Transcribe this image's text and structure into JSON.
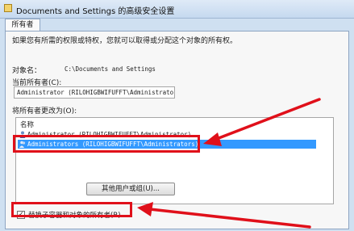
{
  "window": {
    "title": "Documents and Settings 的高级安全设置"
  },
  "tabs": [
    {
      "label": "所有者"
    }
  ],
  "panel": {
    "intro": "如果您有所需的权限或特权，您就可以取得或分配这个对象的所有权。",
    "object_label": "对象名：",
    "object_value": "C:\\Documents and Settings",
    "current_owner_label": "当前所有者(C):",
    "current_owner_value": "Administrator (RILOHIGBWIFUFFT\\Administrator)",
    "change_owner_label": "将所有者更改为(O):",
    "list": {
      "header": "名称",
      "rows": [
        {
          "label": "Administrator (RILOHIGBWIFUFFT\\Administrator)",
          "selected": false,
          "icon": "user-icon"
        },
        {
          "label": "Administrators (RILOHIGBWIFUFFT\\Administrators)",
          "selected": true,
          "icon": "group-icon"
        }
      ]
    },
    "other_users_button": "其他用户或组(U)...",
    "replace_checkbox": {
      "label": "替换子容器和对象的所有者(R)",
      "checked": true
    }
  },
  "colors": {
    "annotation": "#e0101a",
    "selection": "#3399ff"
  }
}
